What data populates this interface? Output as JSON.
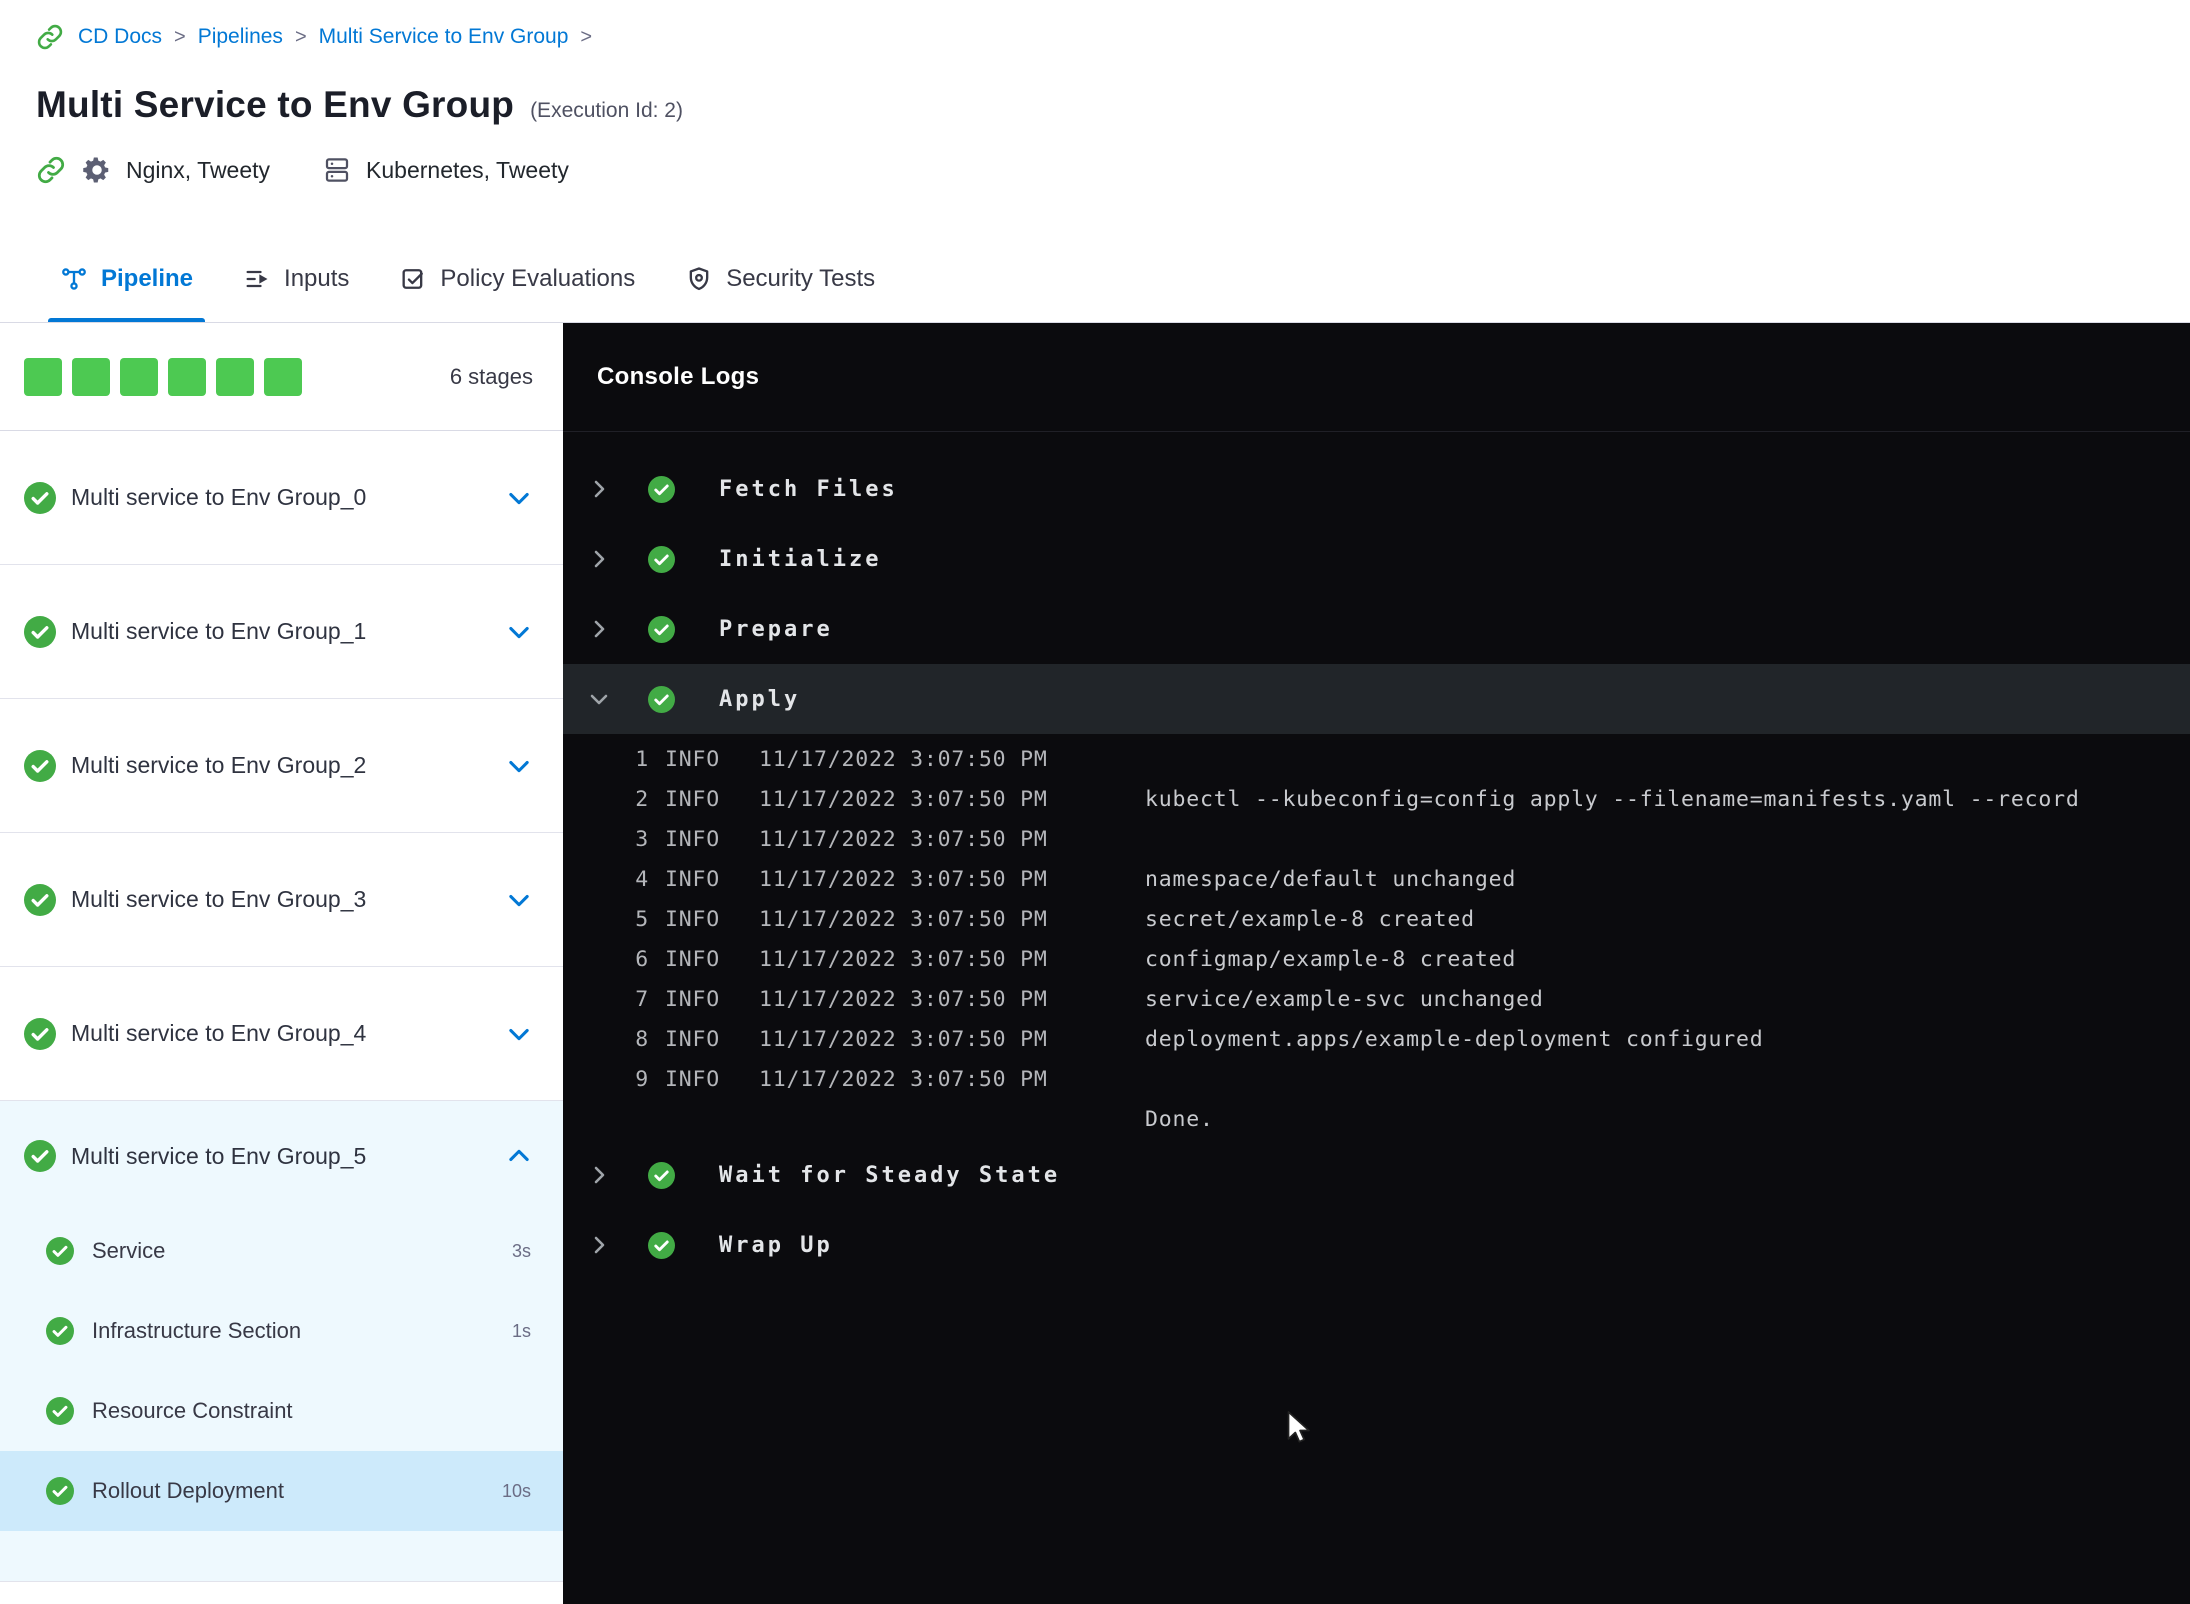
{
  "colors": {
    "accent": "#0278d5",
    "green": "#42ab45",
    "green-bright": "#4dc952",
    "console-bg": "#0b0b0e",
    "expanded-stage-bg": "#eef9fe",
    "selected-step-bg": "#cdeafb"
  },
  "breadcrumb": {
    "separator": ">",
    "items": [
      "CD Docs",
      "Pipelines",
      "Multi Service to Env Group"
    ]
  },
  "header": {
    "title": "Multi Service to Env Group",
    "execution_id": "(Execution Id: 2)",
    "services": "Nginx, Tweety",
    "environments": "Kubernetes, Tweety"
  },
  "tabs": [
    {
      "label": "Pipeline",
      "active": true
    },
    {
      "label": "Inputs",
      "active": false
    },
    {
      "label": "Policy Evaluations",
      "active": false
    },
    {
      "label": "Security Tests",
      "active": false
    }
  ],
  "sidebar": {
    "square_count": 6,
    "stage_count_label": "6 stages",
    "stages": [
      {
        "label": "Multi service to Env Group_0",
        "expanded": false
      },
      {
        "label": "Multi service to Env Group_1",
        "expanded": false
      },
      {
        "label": "Multi service to Env Group_2",
        "expanded": false
      },
      {
        "label": "Multi service to Env Group_3",
        "expanded": false
      },
      {
        "label": "Multi service to Env Group_4",
        "expanded": false
      },
      {
        "label": "Multi service to Env Group_5",
        "expanded": true,
        "steps": [
          {
            "label": "Service",
            "duration": "3s",
            "selected": false
          },
          {
            "label": "Infrastructure Section",
            "duration": "1s",
            "selected": false
          },
          {
            "label": "Resource Constraint",
            "duration": "",
            "selected": false
          },
          {
            "label": "Rollout Deployment",
            "duration": "10s",
            "selected": true
          }
        ]
      }
    ]
  },
  "console": {
    "title": "Console Logs",
    "steps": [
      {
        "label": "Fetch Files",
        "expanded": false
      },
      {
        "label": "Initialize",
        "expanded": false
      },
      {
        "label": "Prepare",
        "expanded": false
      },
      {
        "label": "Apply",
        "expanded": true,
        "logs": [
          {
            "num": "1",
            "level": "INFO",
            "time": "11/17/2022 3:07:50 PM",
            "message": ""
          },
          {
            "num": "2",
            "level": "INFO",
            "time": "11/17/2022 3:07:50 PM",
            "message": "kubectl --kubeconfig=config apply --filename=manifests.yaml --record"
          },
          {
            "num": "3",
            "level": "INFO",
            "time": "11/17/2022 3:07:50 PM",
            "message": ""
          },
          {
            "num": "4",
            "level": "INFO",
            "time": "11/17/2022 3:07:50 PM",
            "message": "namespace/default unchanged"
          },
          {
            "num": "5",
            "level": "INFO",
            "time": "11/17/2022 3:07:50 PM",
            "message": "secret/example-8 created"
          },
          {
            "num": "6",
            "level": "INFO",
            "time": "11/17/2022 3:07:50 PM",
            "message": "configmap/example-8 created"
          },
          {
            "num": "7",
            "level": "INFO",
            "time": "11/17/2022 3:07:50 PM",
            "message": "service/example-svc unchanged"
          },
          {
            "num": "8",
            "level": "INFO",
            "time": "11/17/2022 3:07:50 PM",
            "message": "deployment.apps/example-deployment configured"
          },
          {
            "num": "9",
            "level": "INFO",
            "time": "11/17/2022 3:07:50 PM",
            "message": ""
          },
          {
            "num": "",
            "level": "",
            "time": "",
            "message": "Done."
          }
        ]
      },
      {
        "label": "Wait for Steady State",
        "expanded": false
      },
      {
        "label": "Wrap Up",
        "expanded": false
      }
    ]
  }
}
